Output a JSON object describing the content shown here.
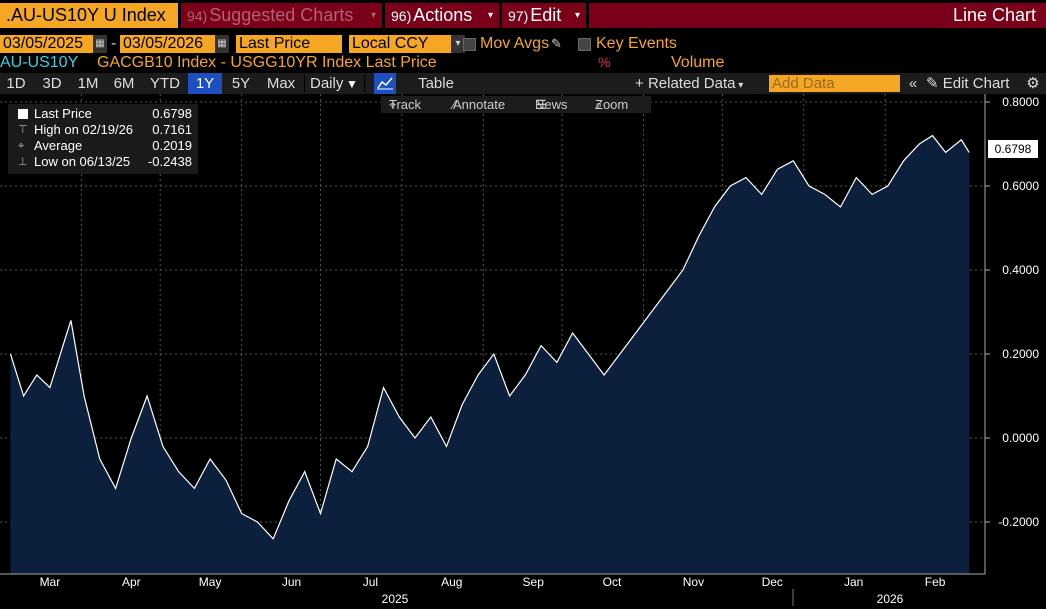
{
  "toolbar": {
    "ticker": ".AU-US10Y U Index",
    "suggested": {
      "num": "94)",
      "label": "Suggested Charts",
      "caret": "▾"
    },
    "actions": {
      "num": "96)",
      "label": "Actions",
      "caret": "▾"
    },
    "edit": {
      "num": "97)",
      "label": "Edit",
      "caret": "▾"
    },
    "chart_type": "Line Chart"
  },
  "settings": {
    "start_date": "03/05/2025",
    "dash": "-",
    "end_date": "03/05/2026",
    "field": "Last Price",
    "currency": "Local CCY",
    "mov_avgs": "Mov Avgs",
    "key_events": "Key Events"
  },
  "series_bar": {
    "short_name": "AU-US10Y",
    "description": "GACGB10 Index - USGG10YR Index Last Price",
    "percent_icon": "%",
    "volume": "Volume"
  },
  "periods": {
    "items": [
      "1D",
      "3D",
      "1M",
      "6M",
      "YTD",
      "1Y",
      "5Y",
      "Max"
    ],
    "selected": "1Y",
    "frequency": "Daily",
    "table": "Table",
    "related": "Related Data",
    "add_placeholder": "Add Data",
    "edit_chart": "Edit Chart"
  },
  "chart_tools": {
    "track": "Track",
    "annotate": "Annotate",
    "news": "News",
    "zoom": "Zoom"
  },
  "legend": {
    "last_label": "Last Price",
    "last_value": "0.6798",
    "high_label": "High on 02/19/26",
    "high_value": "0.7161",
    "avg_label": "Average",
    "avg_value": "0.2019",
    "low_label": "Low on 06/13/25",
    "low_value": "-0.2438"
  },
  "colors": {
    "accent": "#f5a623",
    "toolbar_red": "#7a0019",
    "area_fill": "#0c1f3d",
    "line": "#ffffff",
    "selected_blue": "#1e4fc0",
    "series_text": "#f5a623",
    "short_name_text": "#3ad0e6"
  },
  "chart_data": {
    "type": "area",
    "xlabel_years": [
      "2025",
      "2026"
    ],
    "month_labels": [
      "Mar",
      "Apr",
      "May",
      "Jun",
      "Jul",
      "Aug",
      "Sep",
      "Oct",
      "Nov",
      "Dec",
      "Jan",
      "Feb"
    ],
    "y_ticks": [
      "0.8000",
      "0.6000",
      "0.4000",
      "0.2000",
      "0.0000",
      "-0.2000"
    ],
    "ylim": [
      -0.3,
      0.8
    ],
    "last_value_label": "0.6798",
    "grid": true,
    "x": [
      "2025-03-05",
      "2025-03-10",
      "2025-03-15",
      "2025-03-20",
      "2025-03-25",
      "2025-03-28",
      "2025-04-02",
      "2025-04-08",
      "2025-04-14",
      "2025-04-20",
      "2025-04-26",
      "2025-05-02",
      "2025-05-08",
      "2025-05-14",
      "2025-05-20",
      "2025-05-26",
      "2025-06-01",
      "2025-06-07",
      "2025-06-13",
      "2025-06-19",
      "2025-06-25",
      "2025-07-01",
      "2025-07-07",
      "2025-07-13",
      "2025-07-19",
      "2025-07-25",
      "2025-07-31",
      "2025-08-06",
      "2025-08-12",
      "2025-08-18",
      "2025-08-24",
      "2025-08-30",
      "2025-09-05",
      "2025-09-11",
      "2025-09-17",
      "2025-09-23",
      "2025-09-29",
      "2025-10-05",
      "2025-10-11",
      "2025-10-17",
      "2025-10-23",
      "2025-10-29",
      "2025-11-04",
      "2025-11-10",
      "2025-11-16",
      "2025-11-22",
      "2025-11-28",
      "2025-12-04",
      "2025-12-10",
      "2025-12-16",
      "2025-12-22",
      "2025-12-28",
      "2026-01-03",
      "2026-01-09",
      "2026-01-15",
      "2026-01-21",
      "2026-01-27",
      "2026-02-02",
      "2026-02-08",
      "2026-02-14",
      "2026-02-19",
      "2026-02-24",
      "2026-03-02",
      "2026-03-05"
    ],
    "series": [
      {
        "values": [
          0.2,
          0.1,
          0.15,
          0.12,
          0.22,
          0.28,
          0.1,
          -0.05,
          -0.12,
          0.0,
          0.1,
          -0.02,
          -0.08,
          -0.12,
          -0.05,
          -0.1,
          -0.18,
          -0.2,
          -0.24,
          -0.15,
          -0.08,
          -0.18,
          -0.05,
          -0.08,
          -0.02,
          0.12,
          0.05,
          0.0,
          0.05,
          -0.02,
          0.08,
          0.15,
          0.2,
          0.1,
          0.15,
          0.22,
          0.18,
          0.25,
          0.2,
          0.15,
          0.2,
          0.25,
          0.3,
          0.35,
          0.4,
          0.48,
          0.55,
          0.6,
          0.62,
          0.58,
          0.64,
          0.66,
          0.6,
          0.58,
          0.55,
          0.62,
          0.58,
          0.6,
          0.66,
          0.7,
          0.72,
          0.68,
          0.71,
          0.68
        ]
      }
    ]
  }
}
